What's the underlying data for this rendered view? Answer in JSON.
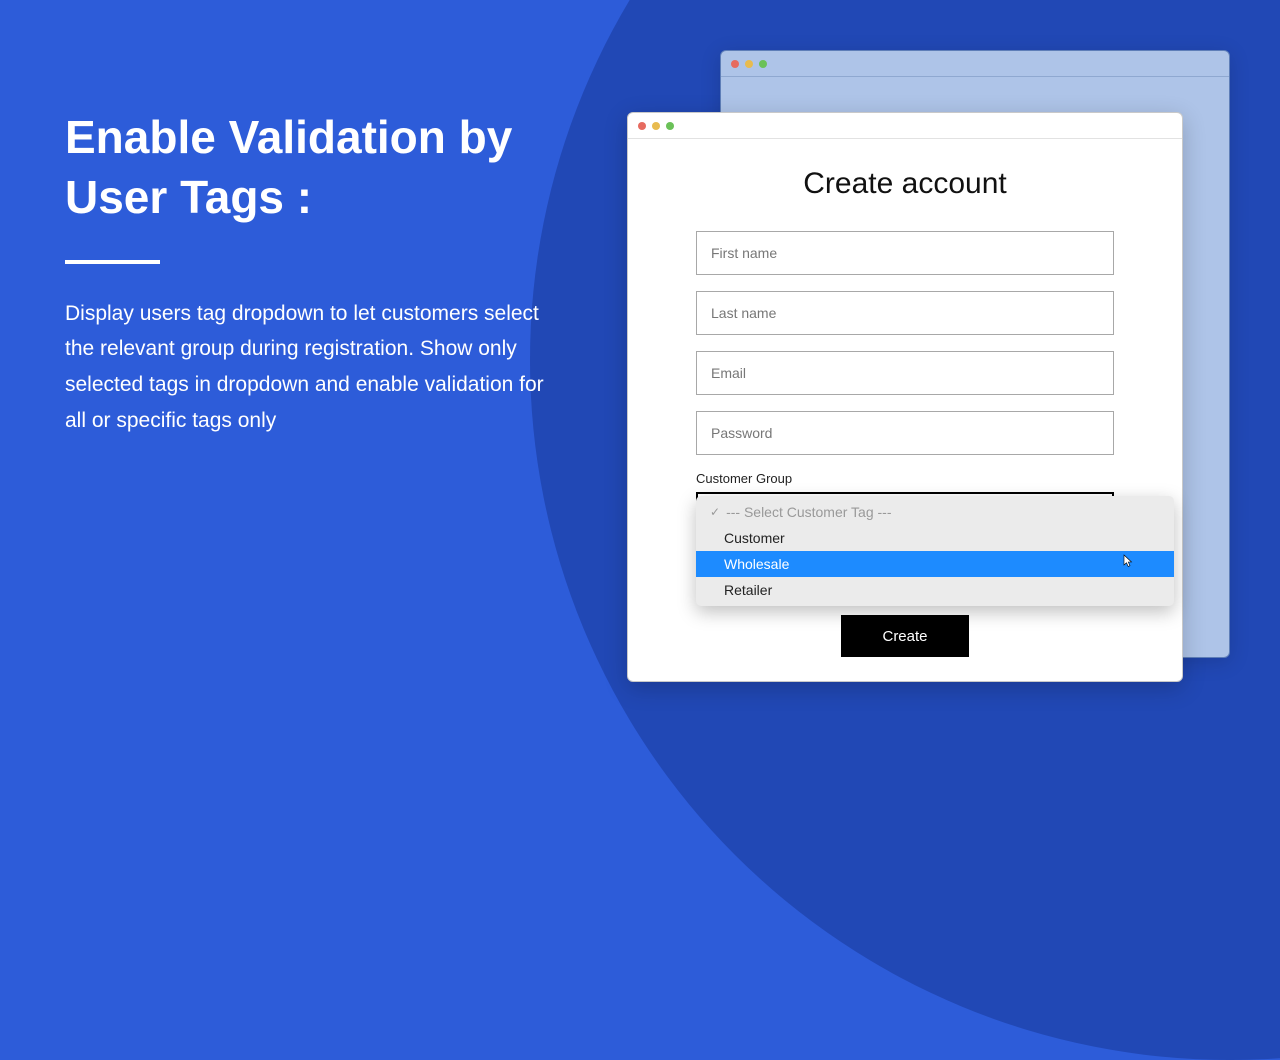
{
  "promo": {
    "heading": "Enable Validation by User Tags :",
    "description": "Display users tag dropdown to let customers select the relevant group during registration. Show only selected tags in dropdown and enable validation for all or specific tags only"
  },
  "window_back": {
    "dots": [
      "#e66b60",
      "#e8bb4f",
      "#6bc158"
    ]
  },
  "window_front": {
    "dots": [
      "#e66b60",
      "#e8bb4f",
      "#6bc158"
    ],
    "title": "Create account",
    "fields": {
      "first_name": {
        "placeholder": "First name"
      },
      "last_name": {
        "placeholder": "Last name"
      },
      "email": {
        "placeholder": "Email"
      },
      "password": {
        "placeholder": "Password"
      }
    },
    "group_label": "Customer Group",
    "dropdown": {
      "placeholder": "--- Select Customer Tag ---",
      "options": [
        "Customer",
        "Wholesale",
        "Retailer"
      ],
      "hovered": "Wholesale"
    },
    "create_button": "Create"
  }
}
